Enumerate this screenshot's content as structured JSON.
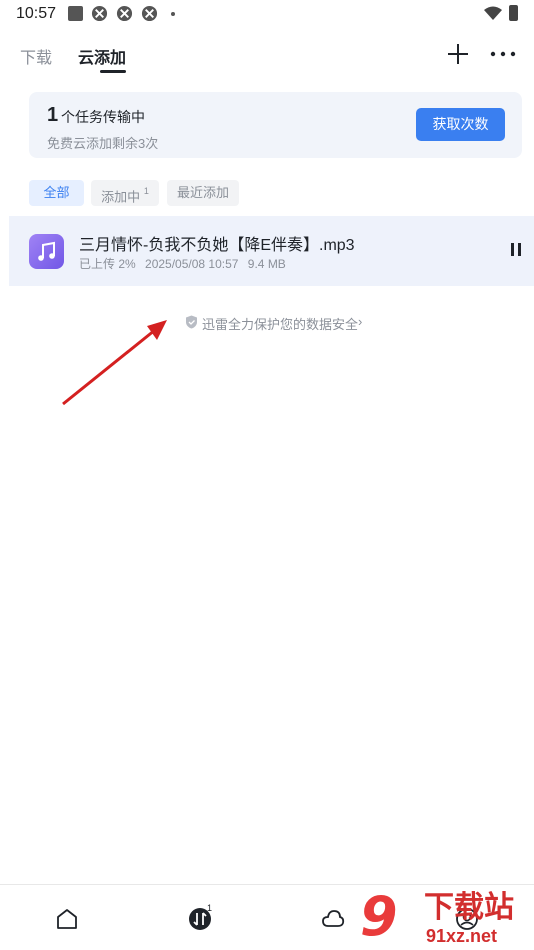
{
  "status_bar": {
    "time": "10:57"
  },
  "header": {
    "tabs": [
      {
        "label": "下载",
        "active": false
      },
      {
        "label": "云添加",
        "active": true
      }
    ]
  },
  "task_card": {
    "count": "1",
    "count_label": "个任务传输中",
    "subtitle": "免费云添加剩余3次",
    "button_label": "获取次数",
    "button_color": "#3a7ff0"
  },
  "filters": {
    "all": "全部",
    "adding": "添加中",
    "adding_badge": "1",
    "recent": "最近添加"
  },
  "file": {
    "name": "三月情怀-负我不负她【降E伴奏】.mp3",
    "status": "已上传 2%",
    "date": "2025/05/08 10:57",
    "size": "9.4 MB",
    "icon": "music-note-icon"
  },
  "security_note": {
    "text": "迅雷全力保护您的数据安全",
    "chevron": "›"
  },
  "bottom_nav": {
    "items": [
      "home-icon",
      "transfer-icon",
      "cloud-icon",
      "profile-icon"
    ],
    "transfer_badge": "1"
  },
  "watermark": {
    "logo": "9",
    "title": "下载站",
    "domain": "91xz.net"
  }
}
